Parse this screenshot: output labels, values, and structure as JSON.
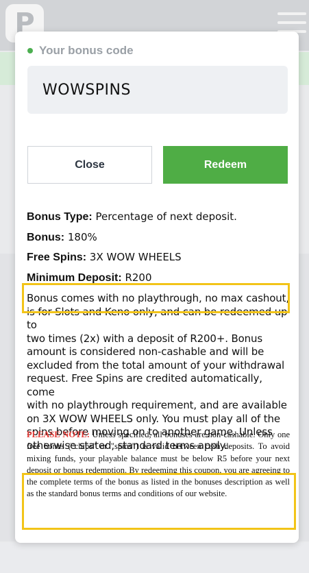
{
  "background": {
    "logo_glyph": "P",
    "logo_icon": "app-logo-icon",
    "menu_icon": "hamburger-menu-icon"
  },
  "modal": {
    "code_label": "Your bonus code",
    "code_value": "WOWSPINS",
    "close_label": "Close",
    "redeem_label": "Redeem",
    "details": [
      {
        "key": "Bonus Type:",
        "value": " Percentage of next deposit."
      },
      {
        "key": "Bonus:",
        "value": " 180%"
      },
      {
        "key": "Free Spins:",
        "value": " 3X WOW WHEELS"
      },
      {
        "key": "Minimum Deposit:",
        "value": " R200"
      }
    ],
    "terms_lines": [
      "Bonus comes with no playthrough, no max cashout,",
      "is for Slots and Keno only, and can be redeemed up to",
      "two times (2x) with a deposit of R200+. Bonus",
      "amount is considered non-cashable and will be",
      "excluded from the total amount of your withdrawal",
      "request. Free Spins are credited automatically, come",
      "with no playthrough requirement, and are available",
      "on 3X WOW WHEELS only. You must play all of the",
      "spins before moving on to another game. Unless",
      "otherwise stated, standard terms apply."
    ],
    "note_label": "PLEASE NOTE:",
    "note_text": " Unless specified, all bonuses are non-cashable. Only one free bonus (\"chips\" or \"spins\") is valid between cash deposits. To avoid mixing funds, your playable balance must be below R5 before your next deposit or bonus redemption. By redeeming this coupon, you are agreeing to the complete terms of the bonus as listed in the bonuses description as well as the standard bonus terms and conditions of our website.",
    "colors": {
      "accent_green": "#4fad45",
      "note_red": "#e53935",
      "highlight_yellow": "#f2c418"
    }
  }
}
